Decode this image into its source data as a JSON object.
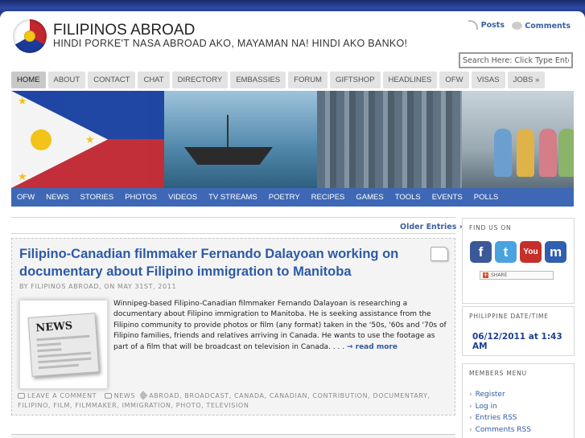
{
  "header": {
    "site_title": "FILIPINOS ABROAD",
    "tagline": "HINDI PORKE'T NASA ABROAD AKO, MAYAMAN NA! HINDI AKO BANKO!",
    "feeds": {
      "posts_label": "Posts",
      "comments_label": "Comments"
    },
    "search_placeholder": "Search Here: Click Type Enter"
  },
  "topnav": {
    "tabs": [
      "HOME",
      "ABOUT",
      "CONTACT",
      "CHAT",
      "DIRECTORY",
      "EMBASSIES",
      "FORUM",
      "GIFTSHOP",
      "HEADLINES",
      "OFW",
      "VISAS",
      "JOBS »"
    ],
    "active": "HOME"
  },
  "subnav": {
    "items": [
      "OFW",
      "NEWS",
      "STORIES",
      "PHOTOS",
      "VIDEOS",
      "TV STREAMS",
      "POETRY",
      "RECIPES",
      "GAMES",
      "TOOLS",
      "EVENTS",
      "POLLS"
    ]
  },
  "main": {
    "older_entries": "Older Entries »",
    "post": {
      "title": "Filipino-Canadian filmmaker Fernando Dalayoan working on documentary about Filipino immigration to Manitoba",
      "byline": "BY FILIPINOS ABROAD, ON MAY 31ST, 2011",
      "thumb_label": "NEWS",
      "excerpt": "Winnipeg-based Filipino-Canadian filmmaker Fernando Dalayoan is researching a documentary about Filipino immigration to Manitoba. He is seeking assistance from the Filipino community to provide photos or film (any format) taken in the '50s, '60s and '70s of Filipino families, friends and relatives arriving in Canada. He wants to use the footage as part of a film that will be broadcast on television in Canada. . . . ",
      "read_more": "→ read more",
      "leave_comment": "LEAVE A COMMENT",
      "category": "NEWS",
      "tags": "ABROAD, BROADCAST, CANADA, CANADIAN, CONTRIBUTION, DOCUMENTARY, FILIPINO, FILM, FILMMAKER, IMMIGRATION, PHOTO, TELEVISION"
    }
  },
  "sidebar": {
    "find_us": {
      "heading": "FIND US ON",
      "icons": [
        {
          "name": "facebook-icon",
          "glyph": "f",
          "color": "#3b5998"
        },
        {
          "name": "twitter-icon",
          "glyph": "t",
          "color": "#4aa3df"
        },
        {
          "name": "youtube-icon",
          "glyph": "You",
          "color": "#c4302b"
        },
        {
          "name": "myspace-icon",
          "glyph": "m",
          "color": "#2f5fb0"
        }
      ],
      "share_label": "SHARE"
    },
    "date": {
      "heading": "PHILIPPINE DATE/TIME",
      "value": "06/12/2011 at 1:43 AM"
    },
    "members": {
      "heading": "MEMBERS MENU",
      "items": [
        "Register",
        "Log in",
        "Entries RSS",
        "Comments RSS"
      ]
    }
  },
  "colors": {
    "link_blue": "#2d5aa5",
    "subnav_blue": "#3e68b5",
    "page_bg": "#1c2e74"
  }
}
